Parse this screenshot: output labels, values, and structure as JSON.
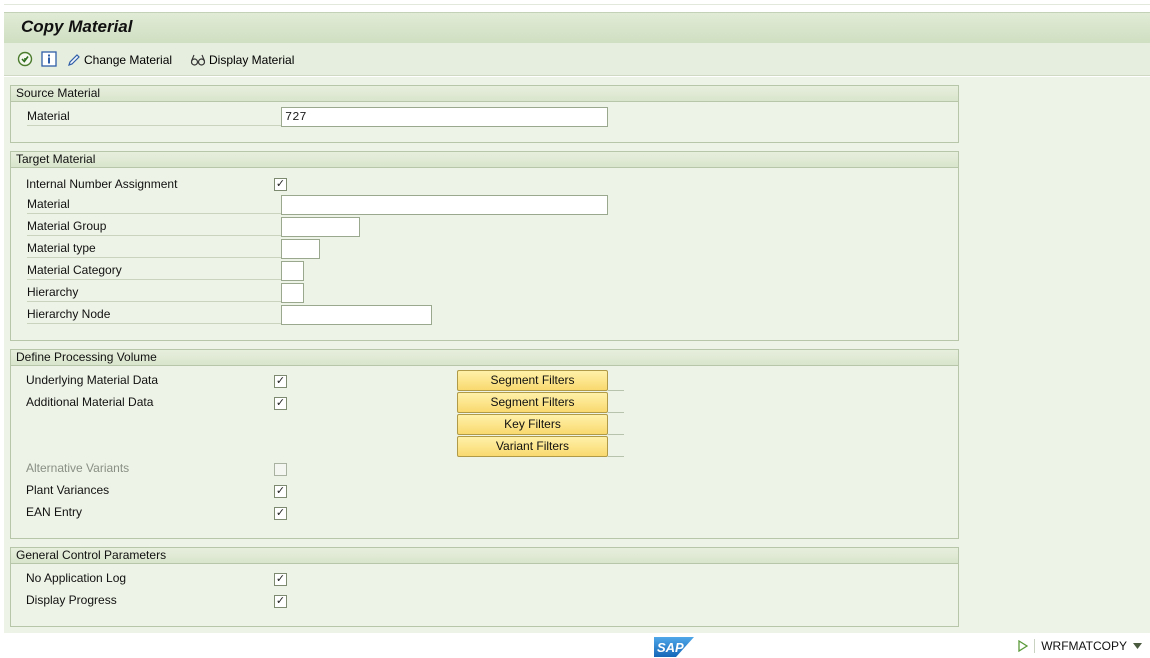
{
  "window": {
    "title": "Copy Material"
  },
  "toolbar": {
    "execute_icon": "execute-icon",
    "info_icon": "info-icon",
    "change_label": "Change Material",
    "display_label": "Display Material"
  },
  "source": {
    "header": "Source Material",
    "material_label": "Material",
    "material_value": "727"
  },
  "target": {
    "header": "Target Material",
    "internal_number_label": "Internal Number Assignment",
    "internal_number_checked": true,
    "material_label": "Material",
    "material_value": "",
    "material_group_label": "Material Group",
    "material_group_value": "",
    "material_type_label": "Material type",
    "material_type_value": "",
    "material_category_label": "Material Category",
    "material_category_value": "",
    "hierarchy_label": "Hierarchy",
    "hierarchy_value": "",
    "hierarchy_node_label": "Hierarchy Node",
    "hierarchy_node_value": ""
  },
  "processing": {
    "header": "Define Processing Volume",
    "underlying_label": "Underlying Material Data",
    "underlying_checked": true,
    "additional_label": "Additional Material Data",
    "additional_checked": true,
    "alt_variants_label": "Alternative Variants",
    "alt_variants_checked": false,
    "plant_variances_label": "Plant Variances",
    "plant_variances_checked": true,
    "ean_label": "EAN Entry",
    "ean_checked": true,
    "buttons": [
      "Segment Filters",
      "Segment Filters",
      "Key Filters",
      "Variant Filters"
    ]
  },
  "control": {
    "header": "General Control Parameters",
    "no_log_label": "No Application Log",
    "no_log_checked": true,
    "progress_label": "Display Progress",
    "progress_checked": true
  },
  "footer": {
    "logo_text": "SAP",
    "transaction": "WRFMATCOPY"
  },
  "colors": {
    "background": "#edf3e6",
    "title_bar": "#d8e6ca",
    "button_yellow": "#fbe38a"
  }
}
